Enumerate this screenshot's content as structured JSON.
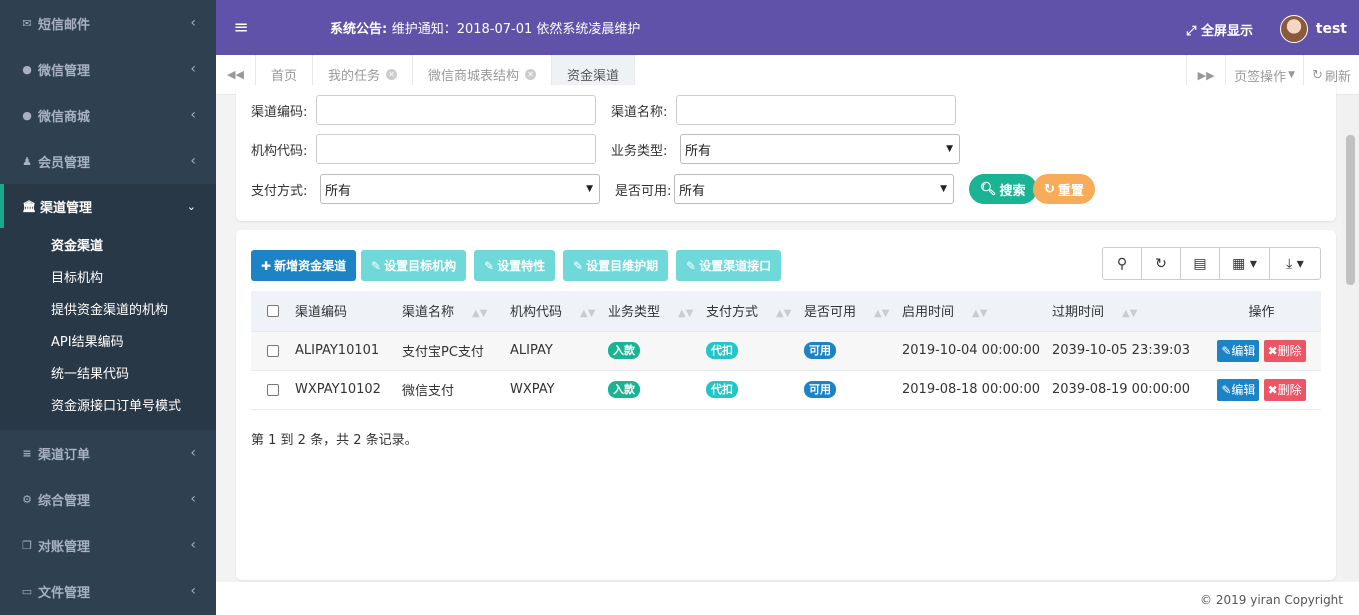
{
  "sidebar": {
    "items": [
      {
        "icon": "✉",
        "label": "短信邮件"
      },
      {
        "icon": "●",
        "label": "微信管理"
      },
      {
        "icon": "●",
        "label": "微信商城"
      },
      {
        "icon": "♟",
        "label": "会员管理"
      },
      {
        "icon": "🏛",
        "label": "渠道管理"
      },
      {
        "icon": "≡",
        "label": "渠道订单"
      },
      {
        "icon": "⚙",
        "label": "综合管理"
      },
      {
        "icon": "❐",
        "label": "对账管理"
      },
      {
        "icon": "▭",
        "label": "文件管理"
      }
    ],
    "chevron": "‹",
    "chevron_open": "⌄",
    "subitems": [
      "资金渠道",
      "目标机构",
      "提供资金渠道的机构",
      "API结果编码",
      "统一结果代码",
      "资金源接口订单号模式"
    ]
  },
  "topbar": {
    "menu_icon": "≡",
    "notice_label": "系统公告:",
    "notice_text": "维护通知：2018-07-01 依然系统凌晨维护",
    "fullscreen": "全屏显示",
    "username": "test"
  },
  "tabs": {
    "items": [
      "首页",
      "我的任务",
      "微信商城表结构",
      "资金渠道"
    ],
    "page_ops": "页签操作",
    "refresh": "刷新"
  },
  "search": {
    "channel_code_label": "渠道编码:",
    "channel_name_label": "渠道名称:",
    "org_code_label": "机构代码:",
    "biz_type_label": "业务类型:",
    "biz_type_value": "所有",
    "pay_method_label": "支付方式:",
    "pay_method_value": "所有",
    "available_label": "是否可用:",
    "available_value": "所有",
    "search_btn": "搜索",
    "reset_btn": "重置"
  },
  "toolbar": {
    "add": "新增资金渠道",
    "set_target": "设置目标机构",
    "set_feature": "设置特性",
    "set_maint": "设置目维护期",
    "set_api": "设置渠道接口"
  },
  "table": {
    "headers": [
      "渠道编码",
      "渠道名称",
      "机构代码",
      "业务类型",
      "支付方式",
      "是否可用",
      "启用时间",
      "过期时间",
      "操作"
    ],
    "rows": [
      {
        "code": "ALIPAY10101",
        "name": "支付宝PC支付",
        "org": "ALIPAY",
        "biz": "入款",
        "pay": "代扣",
        "avail": "可用",
        "start": "2019-10-04 00:00:00",
        "end": "2039-10-05 23:39:03"
      },
      {
        "code": "WXPAY10102",
        "name": "微信支付",
        "org": "WXPAY",
        "biz": "入款",
        "pay": "代扣",
        "avail": "可用",
        "start": "2019-08-18 00:00:00",
        "end": "2039-08-19 00:00:00"
      }
    ],
    "edit": "编辑",
    "delete": "删除",
    "summary": "第 1 到 2 条，共 2 条记录。"
  },
  "colors": {
    "sidebar_bg": "#2f4050",
    "topbar_bg": "#6052a8",
    "primary": "#1c84c6",
    "info": "#23c6c8",
    "success": "#1ab394",
    "warning": "#f8ac59",
    "danger": "#ed5565"
  },
  "footer": {
    "copyright": "© 2019 yiran Copyright"
  }
}
